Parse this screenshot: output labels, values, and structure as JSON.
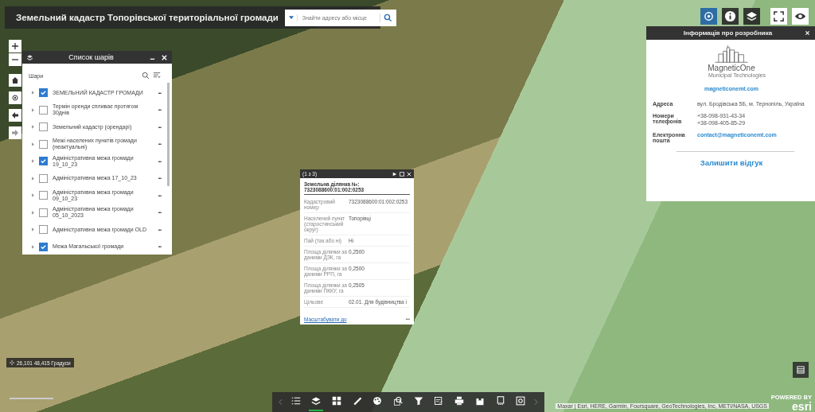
{
  "header": {
    "title": "Земельний кадастр Топорівської територіальної громади",
    "search": {
      "placeholder": "Знайти адресу або місце"
    }
  },
  "top_buttons": [
    {
      "kind": "locate",
      "selected": true
    },
    {
      "kind": "info",
      "selected": false
    },
    {
      "kind": "layers",
      "selected": false
    },
    {
      "kind": "fullscreen",
      "selected": false
    },
    {
      "kind": "eye",
      "selected": false
    }
  ],
  "layer_panel": {
    "title": "Список шарів",
    "section": "Шари",
    "layers": [
      {
        "name": "ЗЕМЕЛЬНИЙ КАДАСТР ГРОМАДИ",
        "checked": true
      },
      {
        "name": "Термін оренди спливає протягом 30днів",
        "checked": false
      },
      {
        "name": "Земельний кадастр (орендарі)",
        "checked": false
      },
      {
        "name": "Межі населених пунктів громади (неактуальні)",
        "checked": false
      },
      {
        "name": "Адміністративна межа громади 19_10_23",
        "checked": true
      },
      {
        "name": "Адміністративна межа 17_10_23",
        "checked": false
      },
      {
        "name": "Адміністративна межа громади 09_10_23",
        "checked": false
      },
      {
        "name": "Адміністративна межа громади 05_10_2023",
        "checked": false
      },
      {
        "name": "Адміністративна межа громади OLD",
        "checked": false
      },
      {
        "name": "Межа Магальської громади",
        "checked": true
      }
    ],
    "more": "•••"
  },
  "popup": {
    "counter": "(1 з 3)",
    "title": "Земельна ділянка №: 7323088600:01:002:0253",
    "fields": [
      {
        "label": "Кадастровий номер",
        "value": "7323088600:01:002:0253"
      },
      {
        "label": "Населений пункт (старостинський округ)",
        "value": "Топорівці"
      },
      {
        "label": "Пай (так або ні)",
        "value": "Ні"
      },
      {
        "label": "Площа ділянки за даними ДЗК, га",
        "value": "0,2500"
      },
      {
        "label": "Площа ділянки за даними РРП, га",
        "value": "0,2500"
      },
      {
        "label": "Площа ділянки за даними ПККУ, га",
        "value": "0,2505"
      },
      {
        "label": "Цільове",
        "value": "02.01. Для будівництва і"
      }
    ],
    "zoom_link": "Масштабувати до",
    "more": "•••"
  },
  "info_panel": {
    "title": "Інформація про розробника",
    "logo_name": "MagneticOne",
    "logo_tagline": "Municipal Technologies",
    "site": "magneticonemt.com",
    "rows": [
      {
        "label": "Адреса",
        "values": [
          "вул. Бродівська 5Б, м. Тернопіль, Україна"
        ],
        "kind": "text"
      },
      {
        "label": "Номери телефонів",
        "values": [
          "+38-098-931-43-34",
          "+38-098-405-85-29"
        ],
        "kind": "text"
      },
      {
        "label": "Електронна пошта",
        "values": [
          "contact@magneticonemt.com"
        ],
        "kind": "link"
      }
    ],
    "feedback": "Залишити відгук"
  },
  "coordinates": "26,101 48,415 Градуси",
  "toolbar": [
    {
      "kind": "list",
      "selected": false
    },
    {
      "kind": "layers",
      "selected": true
    },
    {
      "kind": "grid",
      "selected": false
    },
    {
      "kind": "ruler",
      "selected": false
    },
    {
      "kind": "palette",
      "selected": false
    },
    {
      "kind": "zoom",
      "selected": false
    },
    {
      "kind": "filter",
      "selected": false
    },
    {
      "kind": "edit",
      "selected": false
    },
    {
      "kind": "print",
      "selected": false
    },
    {
      "kind": "bookmark",
      "selected": false
    },
    {
      "kind": "screen",
      "selected": false
    },
    {
      "kind": "capture",
      "selected": false
    }
  ],
  "attribution": "Maxar | Esri, HERE, Garmin, Foursquare, GeoTechnologies, Inc, METI/NASA, USGS",
  "esri": {
    "powered": "POWERED BY",
    "name": "esri"
  }
}
